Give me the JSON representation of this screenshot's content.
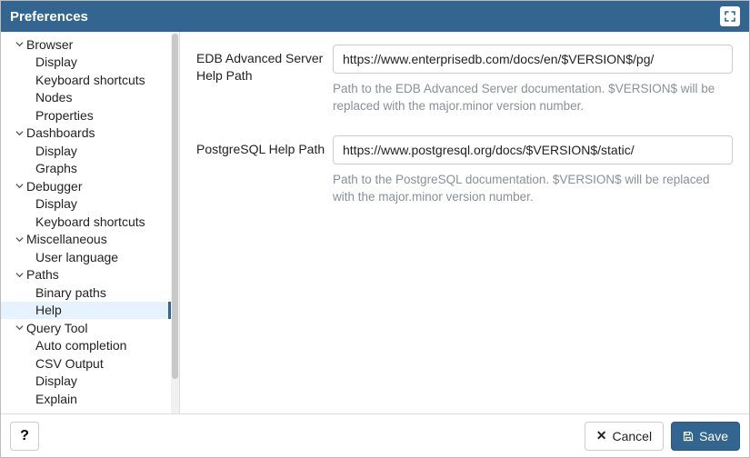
{
  "title": "Preferences",
  "sidebar": {
    "items": [
      {
        "label": "Browser",
        "expandable": true
      },
      {
        "label": "Display",
        "child": true
      },
      {
        "label": "Keyboard shortcuts",
        "child": true
      },
      {
        "label": "Nodes",
        "child": true
      },
      {
        "label": "Properties",
        "child": true
      },
      {
        "label": "Dashboards",
        "expandable": true
      },
      {
        "label": "Display",
        "child": true
      },
      {
        "label": "Graphs",
        "child": true
      },
      {
        "label": "Debugger",
        "expandable": true
      },
      {
        "label": "Display",
        "child": true
      },
      {
        "label": "Keyboard shortcuts",
        "child": true
      },
      {
        "label": "Miscellaneous",
        "expandable": true
      },
      {
        "label": "User language",
        "child": true
      },
      {
        "label": "Paths",
        "expandable": true
      },
      {
        "label": "Binary paths",
        "child": true
      },
      {
        "label": "Help",
        "child": true,
        "selected": true
      },
      {
        "label": "Query Tool",
        "expandable": true
      },
      {
        "label": "Auto completion",
        "child": true
      },
      {
        "label": "CSV Output",
        "child": true
      },
      {
        "label": "Display",
        "child": true
      },
      {
        "label": "Explain",
        "child": true
      }
    ]
  },
  "fields": {
    "edb": {
      "label": "EDB Advanced Server Help Path",
      "value": "https://www.enterprisedb.com/docs/en/$VERSION$/pg/",
      "help": "Path to the EDB Advanced Server documentation. $VERSION$ will be replaced with the major.minor version number."
    },
    "pg": {
      "label": "PostgreSQL Help Path",
      "value": "https://www.postgresql.org/docs/$VERSION$/static/",
      "help": "Path to the PostgreSQL documentation. $VERSION$ will be replaced with the major.minor version number."
    }
  },
  "footer": {
    "help": "?",
    "cancel": "Cancel",
    "save": "Save"
  }
}
